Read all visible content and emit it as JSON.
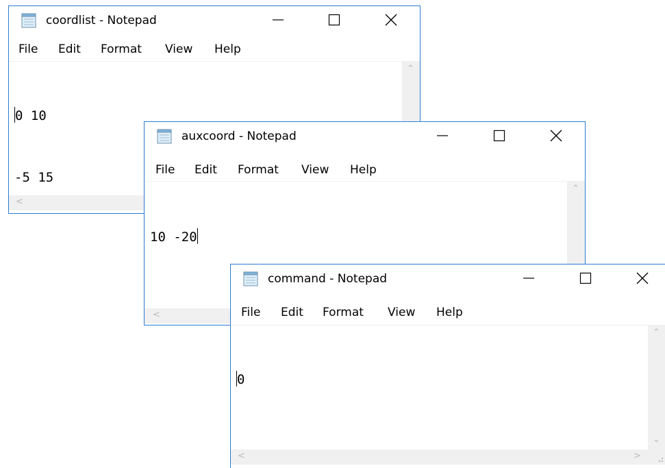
{
  "menu": {
    "file": "File",
    "edit": "Edit",
    "format": "Format",
    "view": "View",
    "help": "Help"
  },
  "windows": [
    {
      "title": "coordlist - Notepad",
      "lines": [
        "0 10",
        "-5 15"
      ]
    },
    {
      "title": "auxcoord - Notepad",
      "lines": [
        "10 -20"
      ]
    },
    {
      "title": "command - Notepad",
      "lines": [
        "0"
      ]
    }
  ],
  "icons": {
    "app": "notepad-icon",
    "minimize": "minimize-icon",
    "maximize": "maximize-icon",
    "close": "close-icon",
    "scroll_up": "scroll-up-arrow-icon",
    "scroll_down": "scroll-down-arrow-icon",
    "scroll_left": "scroll-left-arrow-icon",
    "scroll_right": "scroll-right-arrow-icon",
    "size_grip": "size-grip-icon"
  },
  "colors": {
    "border": "#2b7bd1",
    "scrollbar": "#f0f0f0",
    "text": "#000000"
  }
}
